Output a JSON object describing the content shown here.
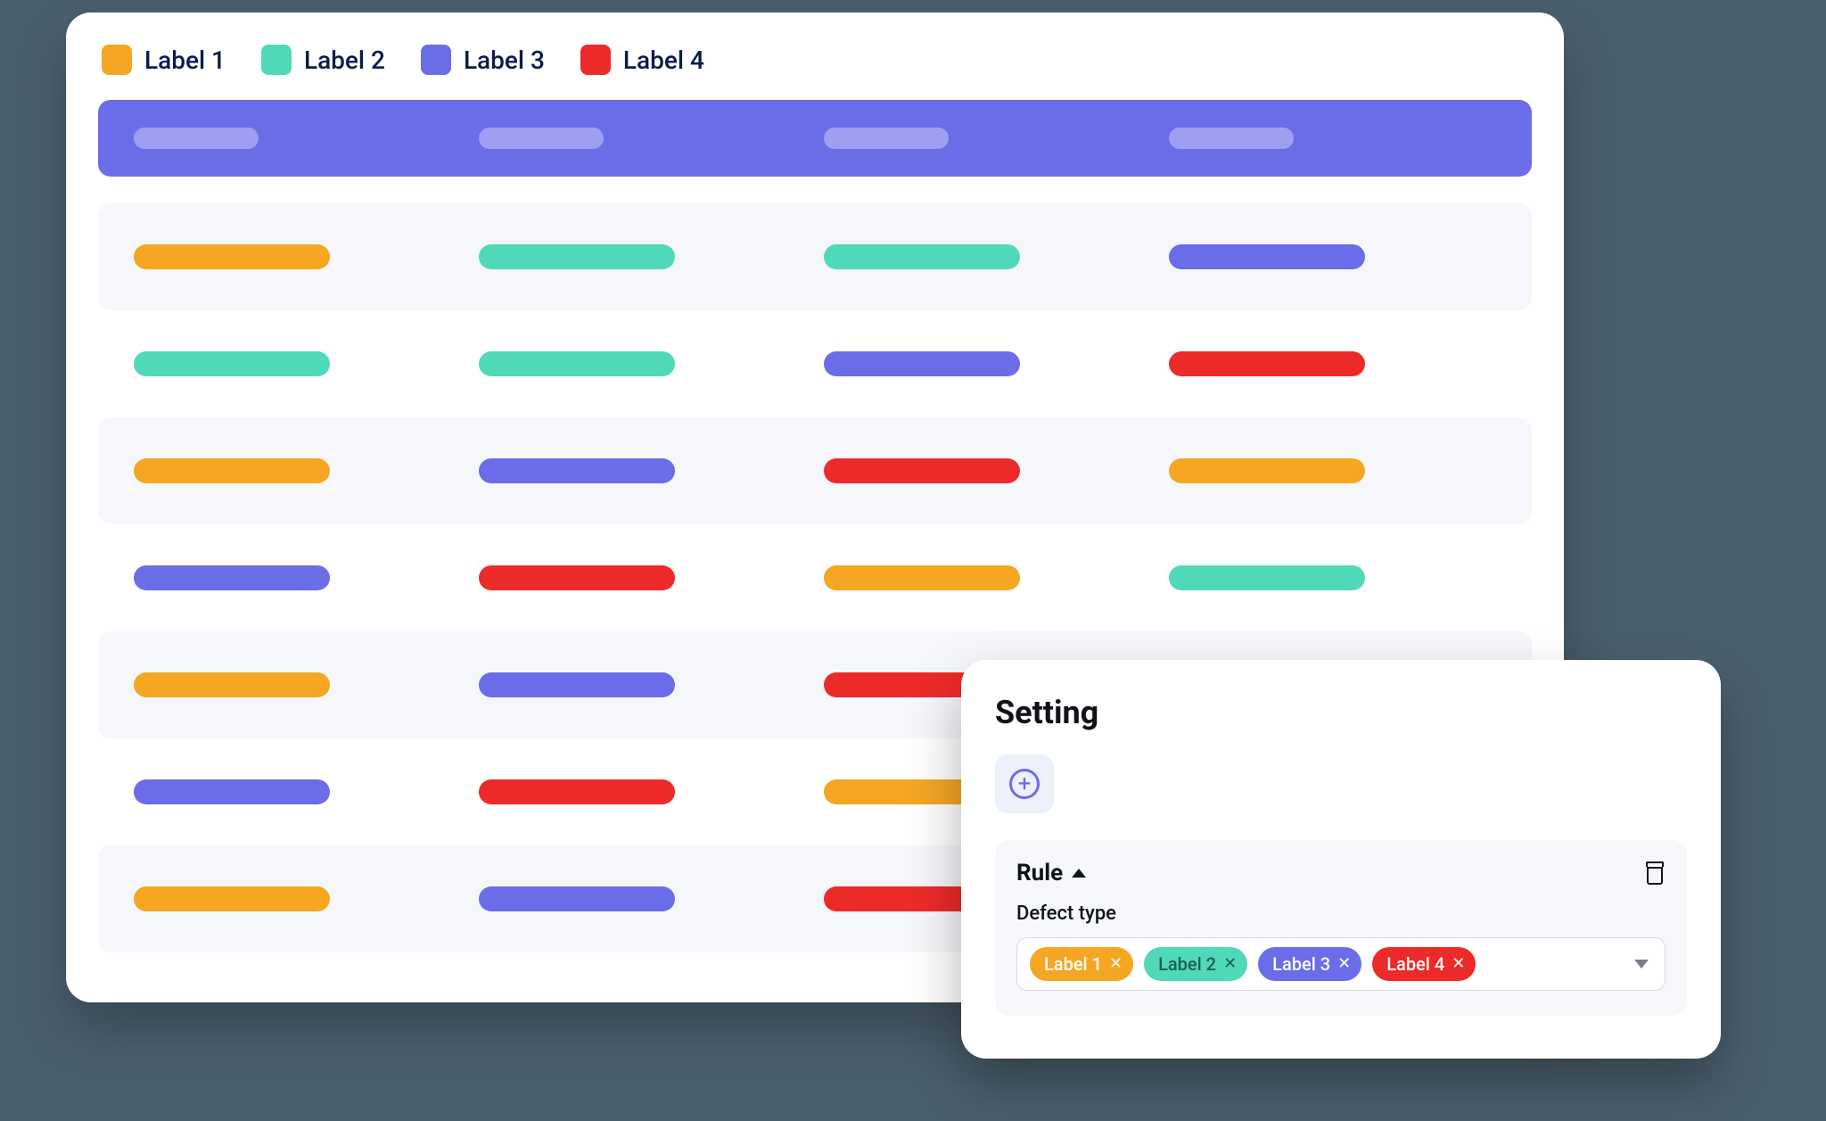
{
  "legend": [
    {
      "label": "Label 1",
      "color": "orange"
    },
    {
      "label": "Label 2",
      "color": "mint"
    },
    {
      "label": "Label 3",
      "color": "blue"
    },
    {
      "label": "Label 4",
      "color": "red"
    }
  ],
  "header_columns": 4,
  "rows": [
    {
      "alt": true,
      "cells": [
        "orange",
        "mint",
        "mint",
        "blue"
      ]
    },
    {
      "alt": false,
      "cells": [
        "mint",
        "mint",
        "blue",
        "red"
      ]
    },
    {
      "alt": true,
      "cells": [
        "orange",
        "blue",
        "red",
        "orange"
      ]
    },
    {
      "alt": false,
      "cells": [
        "blue",
        "red",
        "orange",
        "mint"
      ]
    },
    {
      "alt": true,
      "cells": [
        "orange",
        "blue",
        "red",
        "red"
      ]
    },
    {
      "alt": false,
      "cells": [
        "blue",
        "red",
        "orange",
        "red"
      ]
    },
    {
      "alt": true,
      "cells": [
        "orange",
        "blue",
        "red",
        "orange"
      ]
    }
  ],
  "settings": {
    "title": "Setting",
    "rule": {
      "title": "Rule",
      "field_label": "Defect type",
      "chips": [
        {
          "label": "Label 1",
          "color": "orange"
        },
        {
          "label": "Label 2",
          "color": "mint"
        },
        {
          "label": "Label 3",
          "color": "blue"
        },
        {
          "label": "Label 4",
          "color": "red"
        }
      ]
    }
  }
}
